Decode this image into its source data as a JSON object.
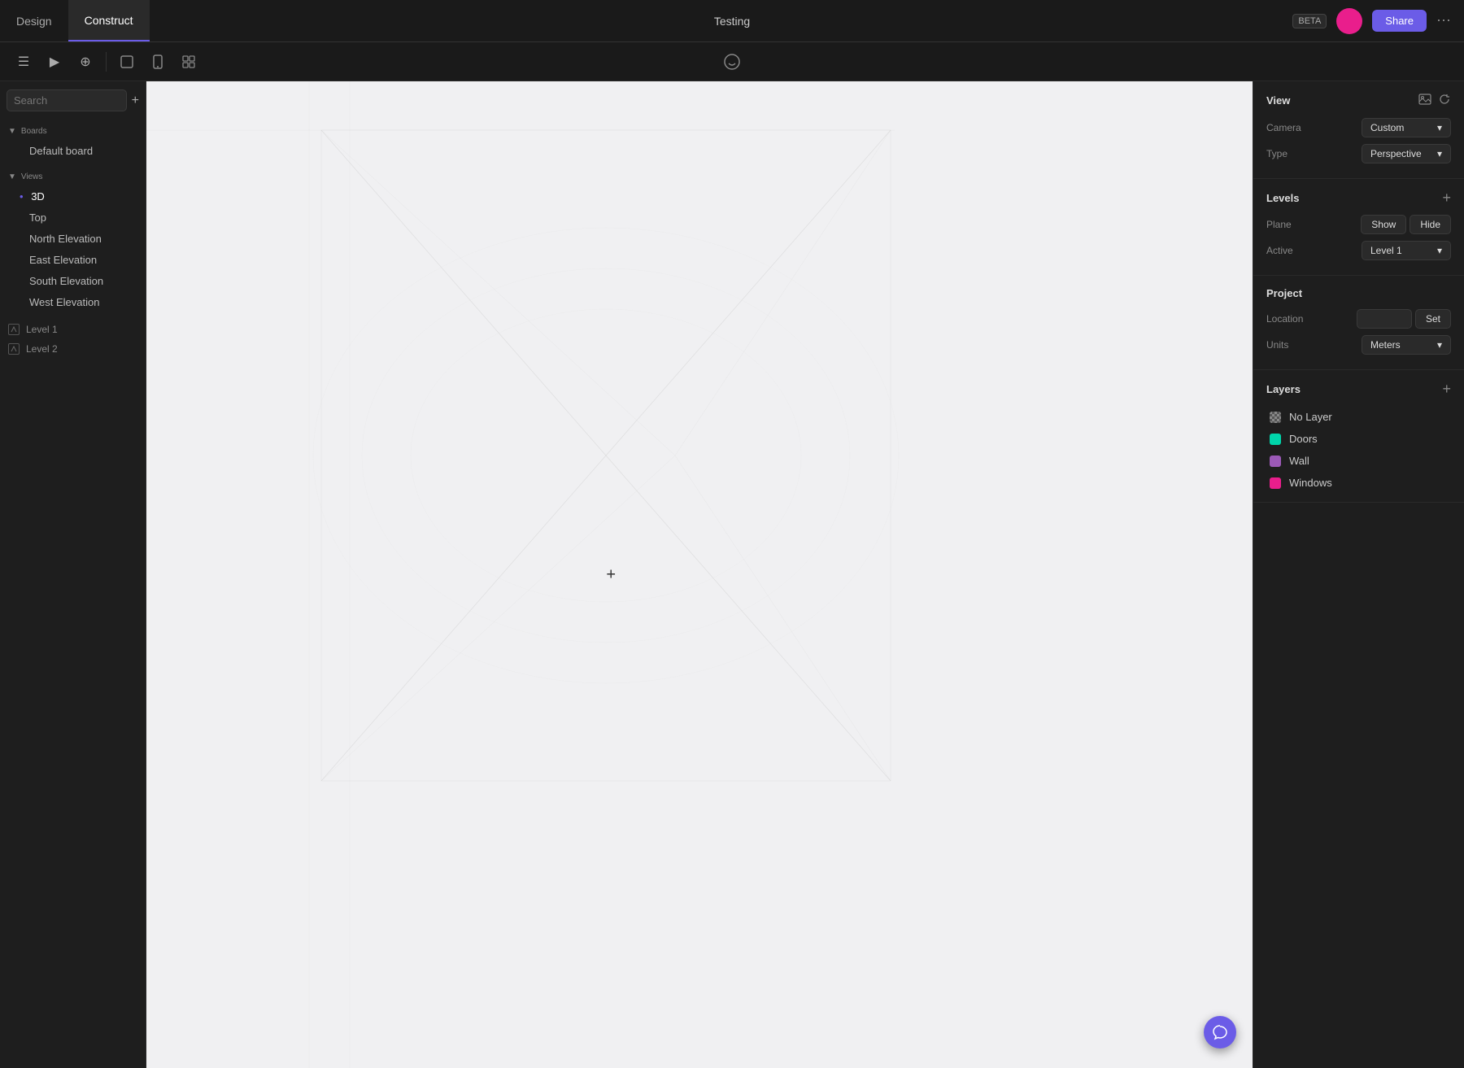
{
  "topbar": {
    "tabs": [
      {
        "label": "Design",
        "active": false
      },
      {
        "label": "Construct",
        "active": true
      }
    ],
    "title": "Testing",
    "beta_label": "BETA",
    "share_label": "Share"
  },
  "toolbar": {
    "icons": [
      "≡",
      "▶",
      "⊕",
      "□",
      "📱",
      "⊞"
    ],
    "comment_icon": "💬"
  },
  "sidebar": {
    "search_placeholder": "Search",
    "boards_label": "Boards",
    "default_board_label": "Default board",
    "views_label": "Views",
    "views": [
      {
        "label": "3D",
        "active": true,
        "indent": false
      },
      {
        "label": "Top",
        "active": false,
        "indent": true
      },
      {
        "label": "North Elevation",
        "active": false,
        "indent": true
      },
      {
        "label": "East Elevation",
        "active": false,
        "indent": true
      },
      {
        "label": "South Elevation",
        "active": false,
        "indent": true
      },
      {
        "label": "West Elevation",
        "active": false,
        "indent": true
      }
    ],
    "levels": [
      {
        "label": "Level 1"
      },
      {
        "label": "Level 2"
      }
    ]
  },
  "right_panel": {
    "view_section": {
      "title": "View",
      "camera_label": "Camera",
      "camera_value": "Custom",
      "type_label": "Type",
      "type_value": "Perspective"
    },
    "levels_section": {
      "title": "Levels",
      "plane_label": "Plane",
      "show_label": "Show",
      "hide_label": "Hide",
      "active_label": "Active",
      "active_value": "Level 1"
    },
    "project_section": {
      "title": "Project",
      "location_label": "Location",
      "set_label": "Set",
      "units_label": "Units",
      "units_value": "Meters"
    },
    "layers_section": {
      "title": "Layers",
      "layers": [
        {
          "name": "No Layer",
          "color": "checkerboard"
        },
        {
          "name": "Doors",
          "color": "#00d4aa"
        },
        {
          "name": "Wall",
          "color": "#9b59b6"
        },
        {
          "name": "Windows",
          "color": "#e91e8c"
        }
      ]
    }
  }
}
